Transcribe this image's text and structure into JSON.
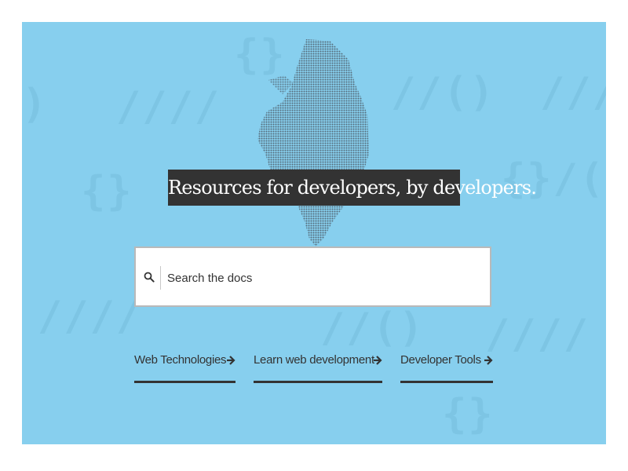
{
  "hero": {
    "headline": "Resources for developers, by developers.",
    "background_color": "#87cfee",
    "mascot": "dinosaur-halftone-graphic"
  },
  "search": {
    "placeholder": "Search the docs",
    "value": "",
    "icon": "search-icon"
  },
  "nav": {
    "links": [
      {
        "label": "Web Technologies",
        "icon": "arrow-right-icon"
      },
      {
        "label": "Learn web development",
        "icon": "arrow-right-icon"
      },
      {
        "label": "Developer Tools",
        "icon": "arrow-right-icon"
      }
    ]
  },
  "colors": {
    "text": "#333333",
    "headline_bg": "#333333",
    "headline_text": "#ffffff"
  }
}
